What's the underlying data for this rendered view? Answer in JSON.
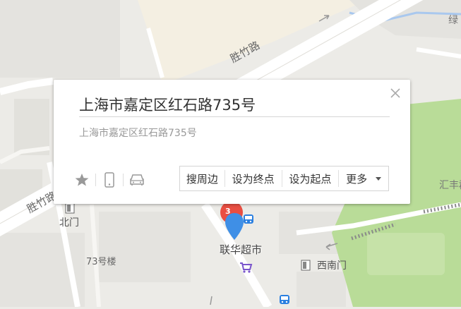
{
  "map": {
    "roads": [
      "胜竹路",
      "胜竹路"
    ],
    "labels": {
      "north_gate": "北门",
      "building_73": "73号楼",
      "south_west_gate": "西南门",
      "huifeng": "汇丰郡",
      "green_top": "绿"
    },
    "poi": {
      "name": "联华超市",
      "cluster_count": "3"
    }
  },
  "popup": {
    "title": "上海市嘉定区红石路735号",
    "address": "上海市嘉定区红石路735号",
    "actions": {
      "nearby": "搜周边",
      "set_end": "设为终点",
      "set_start": "设为起点",
      "more": "更多"
    }
  },
  "colors": {
    "marker_blue": "#3f8fe6",
    "cluster_red": "#e94e42",
    "park_green": "#b9dc98",
    "road_white": "#ffffff",
    "supermarket_purple": "#7a55cc",
    "bus_blue": "#2a7fe0"
  }
}
